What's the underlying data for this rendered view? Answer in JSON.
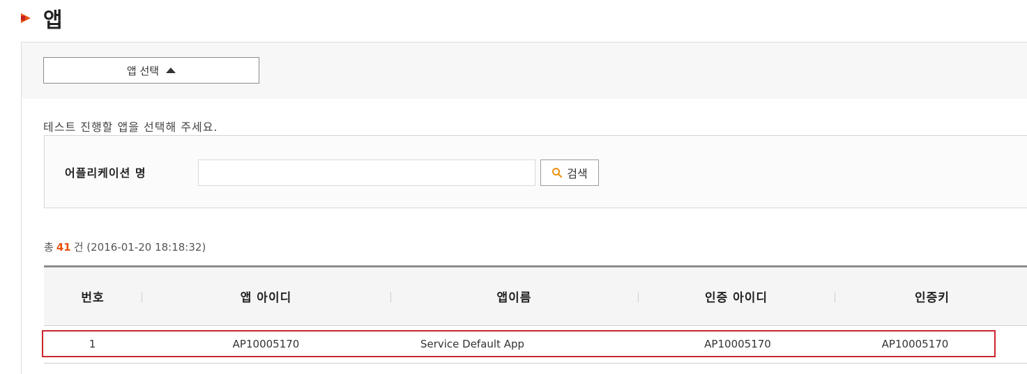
{
  "page": {
    "title": "앱"
  },
  "app_select": {
    "label": "앱 선택",
    "icon": "caret-up-icon"
  },
  "instruction": "테스트 진행할 앱을 선택해 주세요.",
  "search": {
    "label": "어플리케이션 명",
    "value": "",
    "placeholder": "",
    "button_label": "검색",
    "icon": "search-icon"
  },
  "result": {
    "prefix": "총",
    "count": "41",
    "suffix": "건",
    "timestamp": "(2016-01-20 18:18:32)"
  },
  "table": {
    "columns": [
      "번호",
      "앱 아이디",
      "앱이름",
      "인증 아이디",
      "인증키"
    ],
    "rows": [
      [
        "1",
        "AP10005170",
        "Service Default App",
        "AP10005170",
        "AP10005170"
      ]
    ]
  },
  "colors": {
    "accent": "#e8520f",
    "highlight_border": "#c9252b"
  }
}
